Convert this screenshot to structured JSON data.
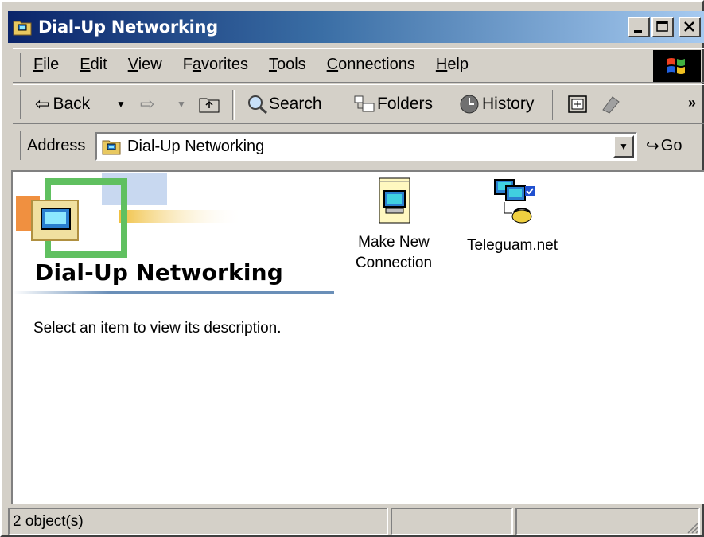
{
  "window": {
    "title": "Dial-Up Networking",
    "buttons": {
      "minimize": "_",
      "maximize": "□",
      "close": "✕"
    }
  },
  "menubar": {
    "items": [
      {
        "label": "File",
        "accel": "F"
      },
      {
        "label": "Edit",
        "accel": "E"
      },
      {
        "label": "View",
        "accel": "V"
      },
      {
        "label": "Favorites",
        "accel": "a"
      },
      {
        "label": "Tools",
        "accel": "T"
      },
      {
        "label": "Connections",
        "accel": "C"
      },
      {
        "label": "Help",
        "accel": "H"
      }
    ]
  },
  "toolbar": {
    "back_label": "Back",
    "search_label": "Search",
    "folders_label": "Folders",
    "history_label": "History",
    "more": "»"
  },
  "addressbar": {
    "label": "Address",
    "value": "Dial-Up Networking",
    "go_label": "Go"
  },
  "content": {
    "folder_title": "Dial-Up Networking",
    "description": "Select an item to view its description.",
    "items": [
      {
        "line1": "Make New",
        "line2": "Connection",
        "icon": "make-new-connection-icon"
      },
      {
        "line1": "Teleguam.net",
        "line2": "",
        "icon": "dialup-connection-icon"
      }
    ]
  },
  "statusbar": {
    "text": "2 object(s)"
  },
  "colors": {
    "titlebar_start": "#0a246a",
    "titlebar_end": "#a6caf0",
    "face": "#d4d0c8"
  }
}
